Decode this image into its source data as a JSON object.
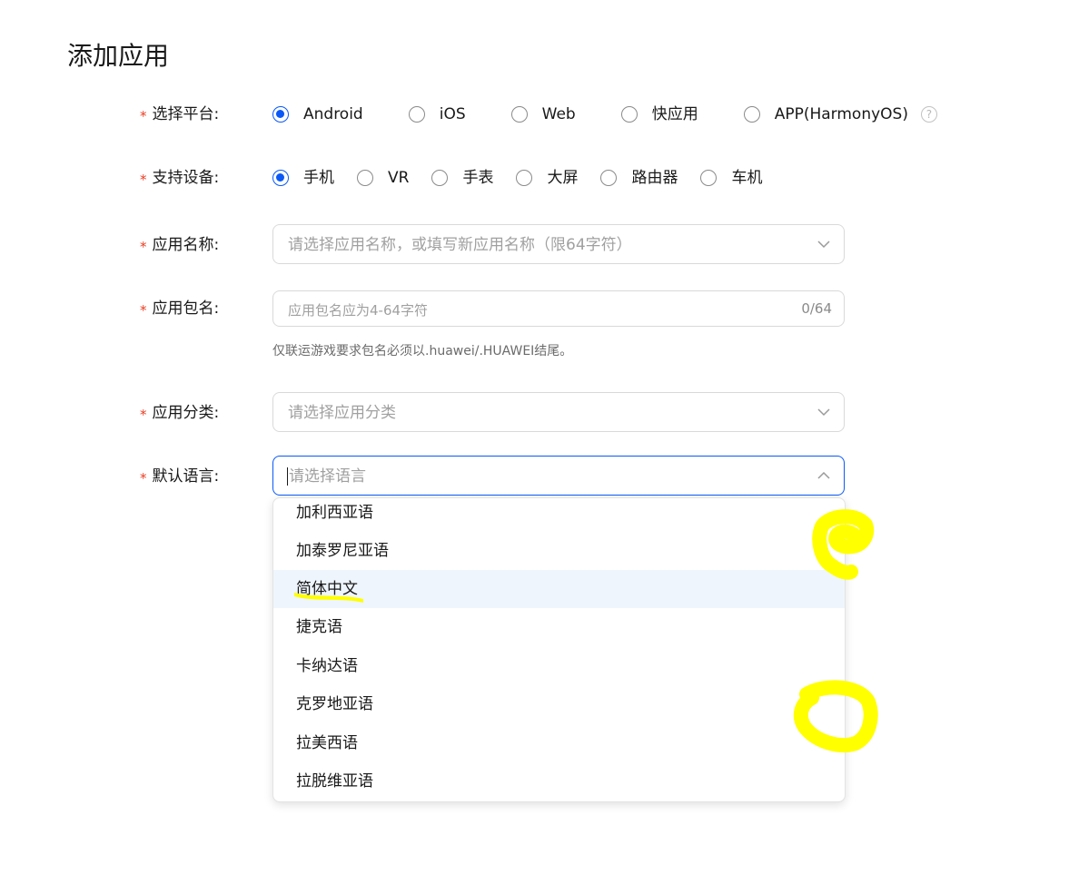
{
  "page": {
    "title": "添加应用"
  },
  "form": {
    "required_mark": "*",
    "platform": {
      "label": "选择平台:",
      "options": [
        "Android",
        "iOS",
        "Web",
        "快应用",
        "APP(HarmonyOS)"
      ],
      "selected": "Android",
      "help_icon": "?"
    },
    "device": {
      "label": "支持设备:",
      "options": [
        "手机",
        "VR",
        "手表",
        "大屏",
        "路由器",
        "车机"
      ],
      "selected": "手机"
    },
    "app_name": {
      "label": "应用名称:",
      "placeholder": "请选择应用名称，或填写新应用名称（限64字符）",
      "icon": "chevron-down-icon"
    },
    "package_name": {
      "label": "应用包名:",
      "placeholder": "应用包名应为4-64字符",
      "counter": "0/64",
      "hint": "仅联运游戏要求包名必须以.huawei/.HUAWEI结尾。"
    },
    "category": {
      "label": "应用分类:",
      "placeholder": "请选择应用分类",
      "icon": "chevron-down-icon"
    },
    "language": {
      "label": "默认语言:",
      "placeholder": "请选择语言",
      "icon": "chevron-up-icon",
      "options": [
        "加利西亚语",
        "加泰罗尼亚语",
        "简体中文",
        "捷克语",
        "卡纳达语",
        "克罗地亚语",
        "拉美西语",
        "拉脱维亚语"
      ],
      "hovered": "简体中文"
    }
  },
  "colors": {
    "accent": "#0a59f7",
    "required": "#e84026",
    "hover_bg": "#eef5fd",
    "highlighter": "#ffff00"
  }
}
